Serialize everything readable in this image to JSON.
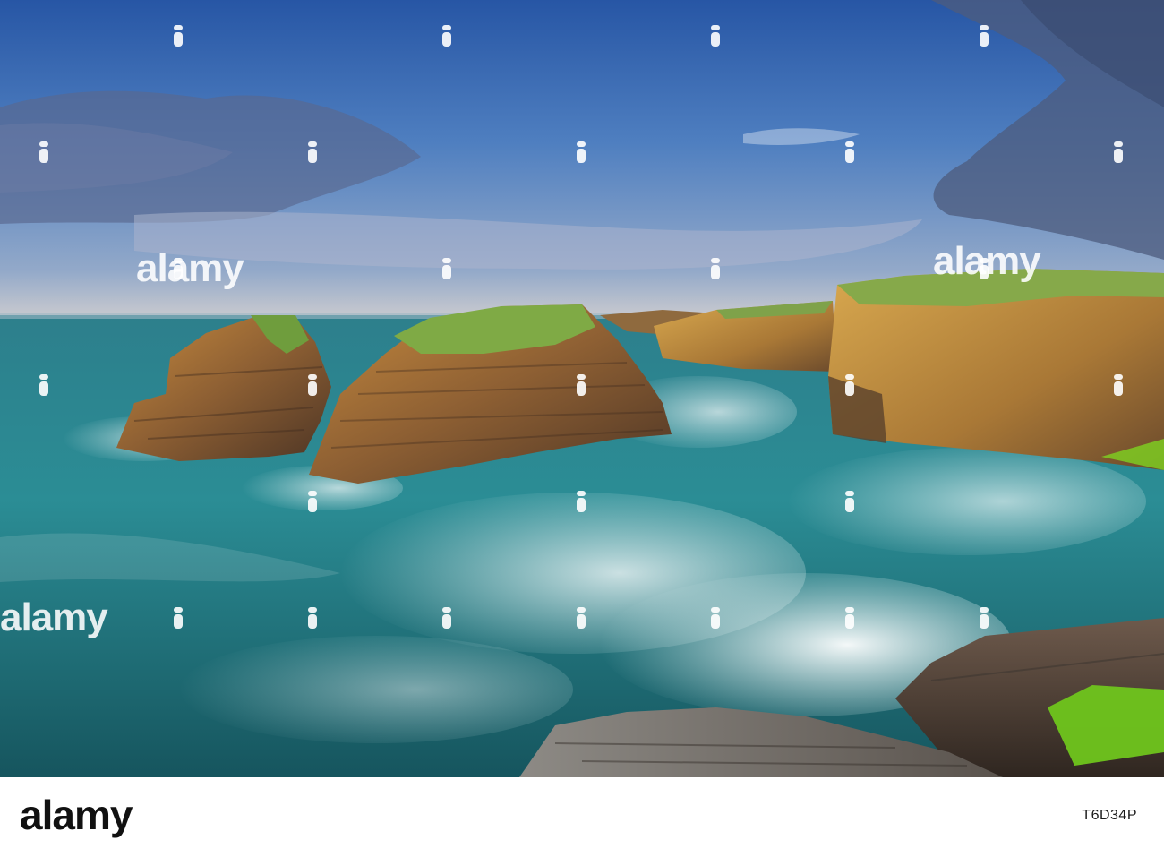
{
  "watermark": {
    "brand": "alamy",
    "image_id": "T6D34P"
  },
  "colors": {
    "sky_top": "#2d5fa8",
    "sky_mid": "#6f97c9",
    "horizon": "#c9c7c9",
    "sea_deep": "#1f6d7b",
    "sea_light": "#3b9aa1",
    "foam": "#eef6f6",
    "cliff_sunlit": "#c9973f",
    "cliff_shadow": "#5b4330",
    "grass": "#7fae4a",
    "moss": "#7ed321"
  }
}
